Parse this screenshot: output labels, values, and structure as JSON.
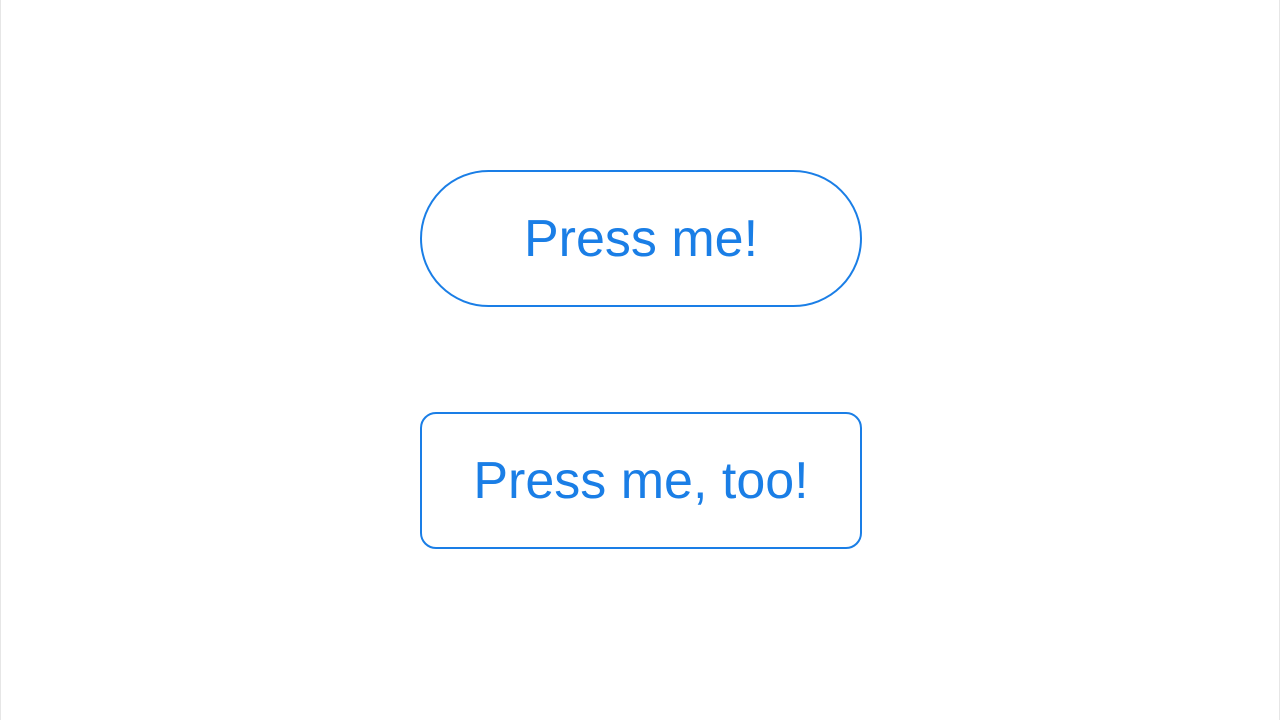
{
  "buttons": {
    "primary_label": "Press me!",
    "secondary_label": "Press me, too!"
  },
  "colors": {
    "accent": "#1a7ee6",
    "background": "#ffffff"
  }
}
